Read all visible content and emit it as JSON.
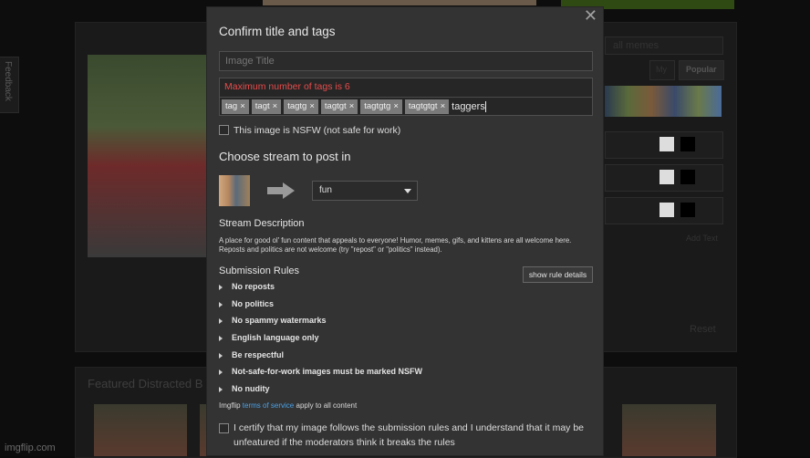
{
  "watermark": "imgflip.com",
  "feedback_tab": "Feedback",
  "background": {
    "featured_heading": "Featured Distracted B",
    "right_panel": {
      "hint": "all memes",
      "tab_my": "My",
      "tab_popular": "Popular",
      "add_text": "Add Text",
      "reset": "Reset"
    }
  },
  "modal": {
    "close_symbol": "✕",
    "title": "Confirm title and tags",
    "image_title_placeholder": "Image Title",
    "tag_error": "Maximum number of tags is 6",
    "tags": [
      "tag",
      "tagt",
      "tagtg",
      "tagtgt",
      "tagtgtg",
      "tagtgtgt"
    ],
    "tag_remove_symbol": "×",
    "tag_input_value": "taggers",
    "nsfw_label": "This image is NSFW (not safe for work)",
    "stream_heading": "Choose stream to post in",
    "stream_selected": "fun",
    "stream_desc_heading": "Stream Description",
    "stream_desc": "A place for good ol' fun content that appeals to everyone! Humor, memes, gifs, and kittens are all welcome here. Reposts and politics are not welcome (try \"repost\" or \"politics\" instead).",
    "rules_heading": "Submission Rules",
    "show_rules_label": "show rule details",
    "rules": [
      "No reposts",
      "No politics",
      "No spammy watermarks",
      "English language only",
      "Be respectful",
      "Not-safe-for-work images must be marked NSFW",
      "No nudity"
    ],
    "tos_prefix": "Imgflip ",
    "tos_link": "terms of service",
    "tos_suffix": " apply to all content",
    "certify_text": "I certify that my image follows the submission rules and I understand that it may be unfeatured if the moderators think it breaks the rules"
  }
}
